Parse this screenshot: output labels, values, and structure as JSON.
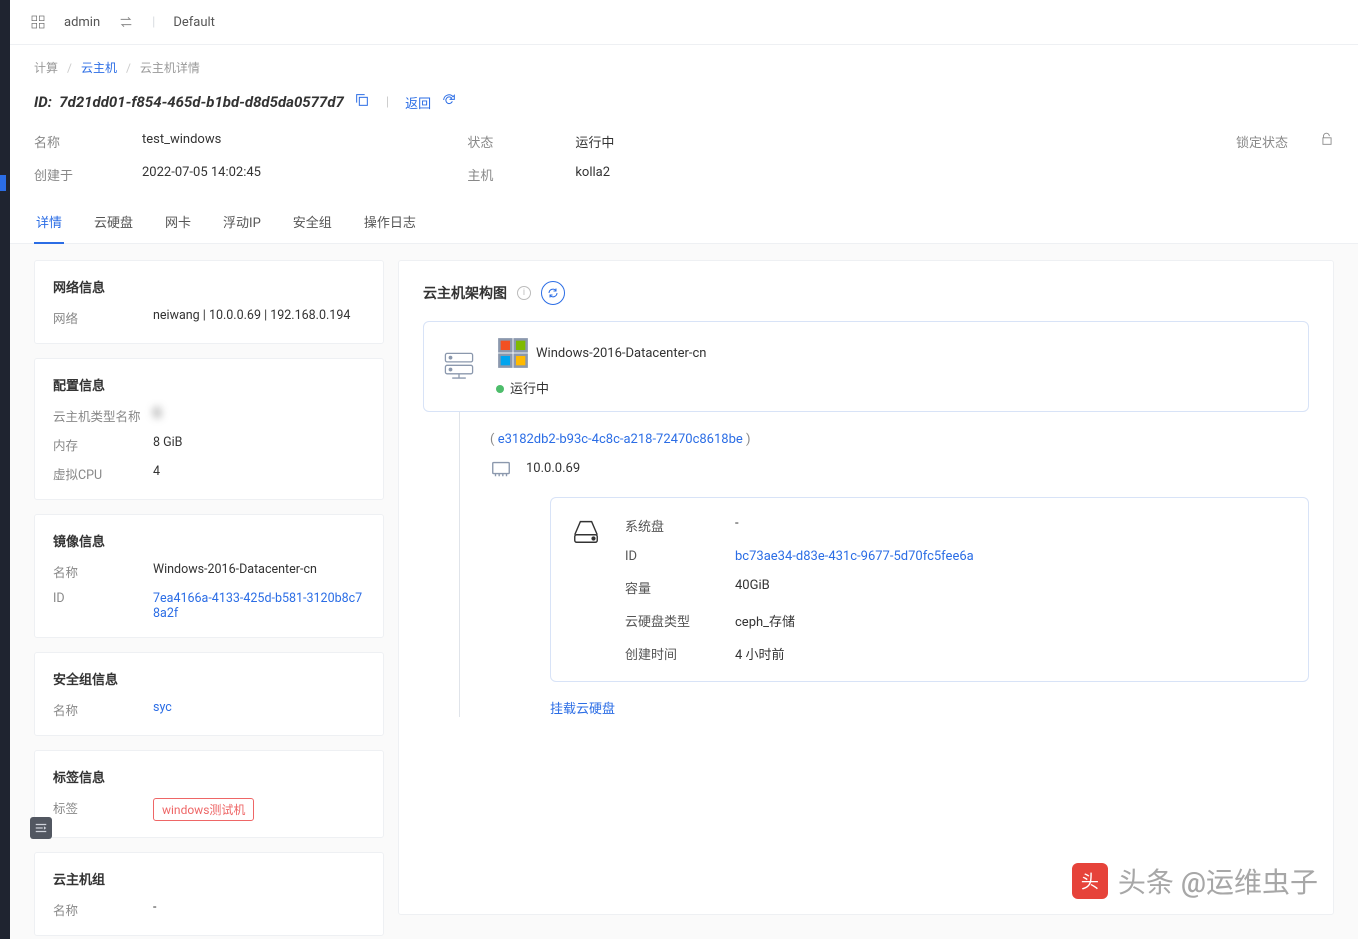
{
  "topbar": {
    "user": "admin",
    "project": "Default"
  },
  "breadcrumb": {
    "l1": "计算",
    "l2": "云主机",
    "l3": "云主机详情"
  },
  "header": {
    "id_label": "ID:",
    "id_value": "7d21dd01-f854-465d-b1bd-d8d5da0577d7",
    "back": "返回"
  },
  "summary": {
    "name_lbl": "名称",
    "name_val": "test_windows",
    "status_lbl": "状态",
    "status_val": "运行中",
    "lock_lbl": "锁定状态",
    "created_lbl": "创建于",
    "created_val": "2022-07-05 14:02:45",
    "host_lbl": "主机",
    "host_val": "kolla2"
  },
  "tabs": [
    "详情",
    "云硬盘",
    "网卡",
    "浮动IP",
    "安全组",
    "操作日志"
  ],
  "net_card": {
    "title": "网络信息",
    "net_lbl": "网络",
    "net_val": "neiwang | 10.0.0.69 | 192.168.0.194"
  },
  "cfg_card": {
    "title": "配置信息",
    "type_lbl": "云主机类型名称",
    "type_val": "G",
    "mem_lbl": "内存",
    "mem_val": "8 GiB",
    "cpu_lbl": "虚拟CPU",
    "cpu_val": "4"
  },
  "img_card": {
    "title": "镜像信息",
    "name_lbl": "名称",
    "name_val": "Windows-2016-Datacenter-cn",
    "id_lbl": "ID",
    "id_val": "7ea4166a-4133-425d-b581-3120b8c78a2f"
  },
  "sg_card": {
    "title": "安全组信息",
    "name_lbl": "名称",
    "name_val": "syc"
  },
  "tag_card": {
    "title": "标签信息",
    "tag_lbl": "标签",
    "tag_val": "windows测试机"
  },
  "grp_card": {
    "title": "云主机组",
    "name_lbl": "名称",
    "name_val": "-"
  },
  "arch": {
    "title": "云主机架构图",
    "vm_name": "Windows-2016-Datacenter-cn",
    "vm_status": "运行中",
    "net_id": "e3182db2-b93c-4c8c-a218-72470c8618be",
    "ip": "10.0.0.69",
    "disk": {
      "sys_lbl": "系统盘",
      "sys_val": "-",
      "id_lbl": "ID",
      "id_val": "bc73ae34-d83e-431c-9677-5d70fc5fee6a",
      "cap_lbl": "容量",
      "cap_val": "40GiB",
      "type_lbl": "云硬盘类型",
      "type_val": "ceph_存储",
      "time_lbl": "创建时间",
      "time_val": "4 小时前"
    },
    "attach": "挂载云硬盘"
  },
  "watermark": "头条 @运维虫子"
}
